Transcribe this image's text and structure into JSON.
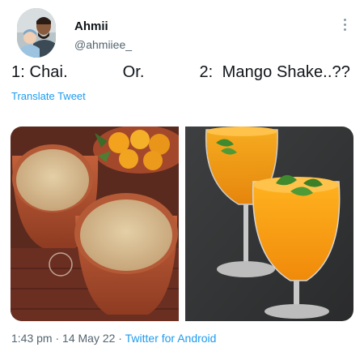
{
  "author": {
    "display_name": "Ahmii",
    "handle": "@ahmiiee_",
    "avatar_icon": "profile-photo"
  },
  "tweet": {
    "text": "1: Chai.            Or.            2:  Mango Shake..??",
    "translate_label": "Translate Tweet",
    "media": [
      {
        "description_icon": "chai-kulhad-photo"
      },
      {
        "description_icon": "mango-shake-photo"
      }
    ]
  },
  "meta": {
    "time": "1:43 pm",
    "separator": " · ",
    "date": "14 May 22",
    "source": "Twitter for Android"
  },
  "colors": {
    "link": "#1d9bf0",
    "secondary_text": "#536471",
    "primary_text": "#0f1419"
  }
}
